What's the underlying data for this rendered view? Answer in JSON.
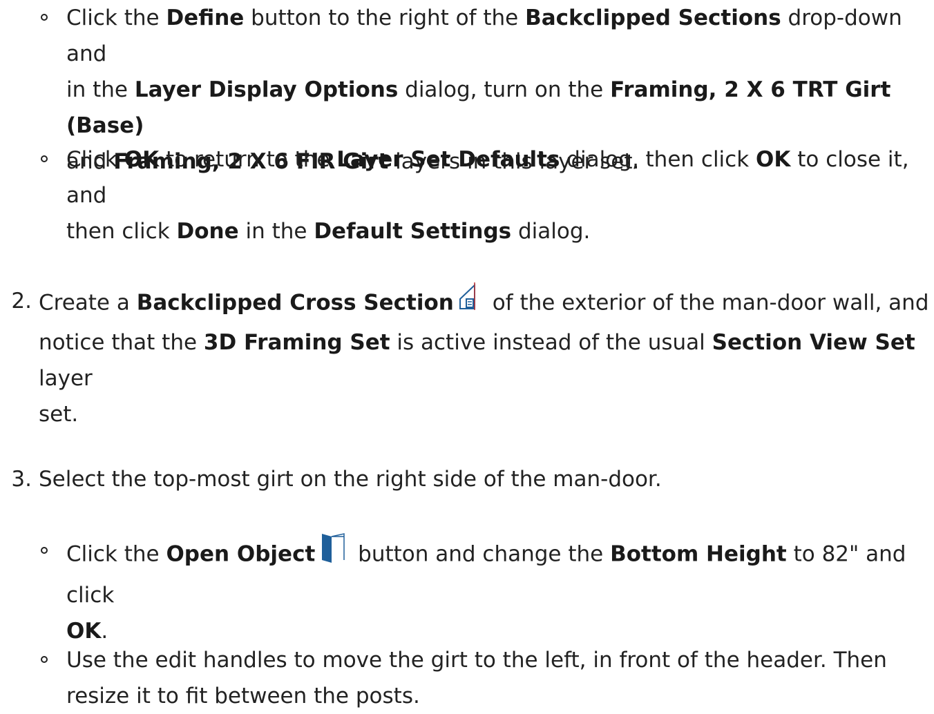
{
  "sub_a": {
    "l1": [
      "Click the ",
      "Define",
      " button to the right of the ",
      "Backclipped Sections",
      " drop-down and"
    ],
    "l2": [
      "in the ",
      "Layer Display Options",
      " dialog, turn on the ",
      "Framing, 2 X 6 TRT Girt (Base)"
    ],
    "l3": [
      "and ",
      "Framing, 2 X 6 FIR Girt",
      " layers in this layer set."
    ]
  },
  "sub_b": {
    "l1": [
      "Click ",
      "OK",
      " to return to the ",
      "Layer Set Defaults",
      " dialog, then click ",
      "OK",
      " to close it, and"
    ],
    "l2": [
      "then click ",
      "Done",
      " in the ",
      "Default Settings",
      " dialog."
    ]
  },
  "step2": {
    "number": "2.",
    "l1": [
      "Create a ",
      "Backclipped Cross Section",
      " of the exterior of the man-door wall, and"
    ],
    "icon": "backclipped-cross-section-icon",
    "l2": [
      "notice that the ",
      "3D Framing Set",
      " is active instead of the usual ",
      "Section View Set",
      " layer"
    ],
    "l3": "set."
  },
  "step3": {
    "number": "3.",
    "text": "Select the top-most girt on the right side of the man-door."
  },
  "sub_c": {
    "l1": [
      "Click the ",
      "Open Object",
      " button and change the ",
      "Bottom Height",
      " to 82\" and click"
    ],
    "icon": "open-object-icon",
    "l2": [
      "OK",
      "."
    ]
  },
  "sub_d": {
    "l1": "Use the edit handles to move the girt to the left, in front of the header. Then",
    "l2": "resize it to fit between the posts."
  },
  "colors": {
    "text": "#222222",
    "icon_blue": "#1f5f9a",
    "icon_red": "#c03030"
  }
}
